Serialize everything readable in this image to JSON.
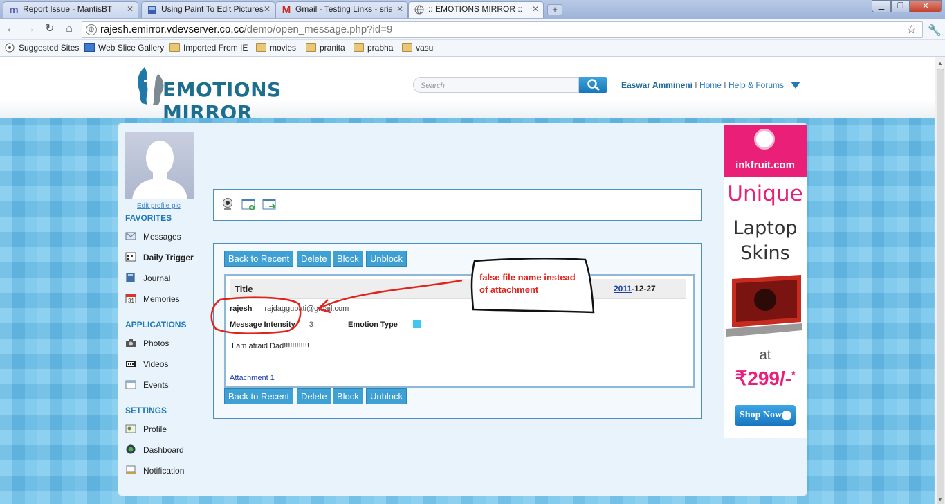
{
  "browser": {
    "tabs": [
      {
        "label": "Report Issue - MantisBT",
        "favicon": "mantis-icon"
      },
      {
        "label": "Using Paint To Edit Pictures",
        "favicon": "page-icon"
      },
      {
        "label": "Gmail - Testing Links - sriak",
        "favicon": "gmail-icon"
      },
      {
        "label": ":: EMOTIONS MIRROR ::",
        "favicon": "globe-icon",
        "active": true
      }
    ],
    "url_host": "rajesh.emirror.vdevserver.co.cc",
    "url_path": "/demo/open_message.php?id=9",
    "bookmarks": [
      "Suggested Sites",
      "Web Slice Gallery",
      "Imported From IE",
      "movies",
      "pranita",
      "prabha",
      "vasu"
    ]
  },
  "site": {
    "logo_text": "EMOTIONS MIRROR",
    "search_placeholder": "Search",
    "user_name": "Easwar Ammineni",
    "nav_home": "Home",
    "nav_help": "Help & Forums"
  },
  "sidebar": {
    "edit_pic": "Edit profile pic",
    "favorites_title": "FAVORITES",
    "favorites": [
      "Messages",
      "Daily Trigger",
      "Journal",
      "Memories"
    ],
    "applications_title": "APPLICATIONS",
    "applications": [
      "Photos",
      "Videos",
      "Events"
    ],
    "settings_title": "SETTINGS",
    "settings": [
      "Profile",
      "Dashboard",
      "Notification"
    ]
  },
  "actions": {
    "back": "Back to Recent",
    "delete": "Delete",
    "block": "Block",
    "unblock": "Unblock"
  },
  "message": {
    "title_label": "Title",
    "date_year": "2011",
    "date_rest": "-12-27",
    "sender": "rajesh",
    "sender_email": "rajdaggubati@gmail.com",
    "intensity_label": "Message Intensity",
    "intensity_value": "3",
    "emotion_label": "Emotion Type",
    "emotion_color": "#42c6ee",
    "body": "I am afraid Dad!!!!!!!!!!!!",
    "attachment": "Attachment 1"
  },
  "ad": {
    "brand": "inkfruit.com",
    "headline1": "Unique",
    "headline2": "Laptop",
    "headline3": "Skins",
    "at": "at",
    "price": "₹299/-",
    "price_mark": "*",
    "cta": "Shop Now"
  },
  "annotation": {
    "note_line1": "false file name instead",
    "note_line2": "of attachment",
    "color": "#e2231a"
  }
}
